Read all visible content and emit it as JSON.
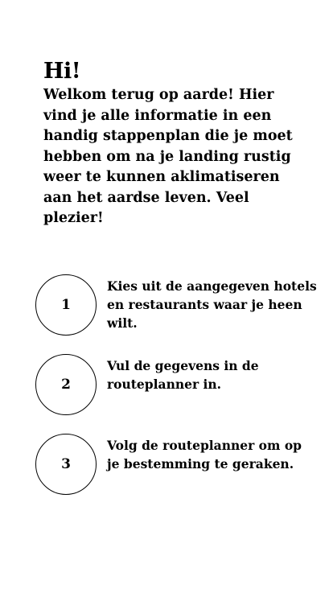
{
  "intro": {
    "greeting": "Hi!",
    "text": "Welkom terug op aarde! Hier vind je alle informatie in een handig stappenplan die je moet hebben om na je landing rustig weer te kunnen aklimatiseren aan het aardse leven. Veel plezier!"
  },
  "steps": [
    {
      "number": "1",
      "text": "Kies uit de aangegeven hotels en restaurants waar je heen wilt."
    },
    {
      "number": "2",
      "text": "Vul de gegevens in de routeplanner in."
    },
    {
      "number": "3",
      "text": "Volg de routeplanner om op je bestemming te geraken."
    }
  ]
}
